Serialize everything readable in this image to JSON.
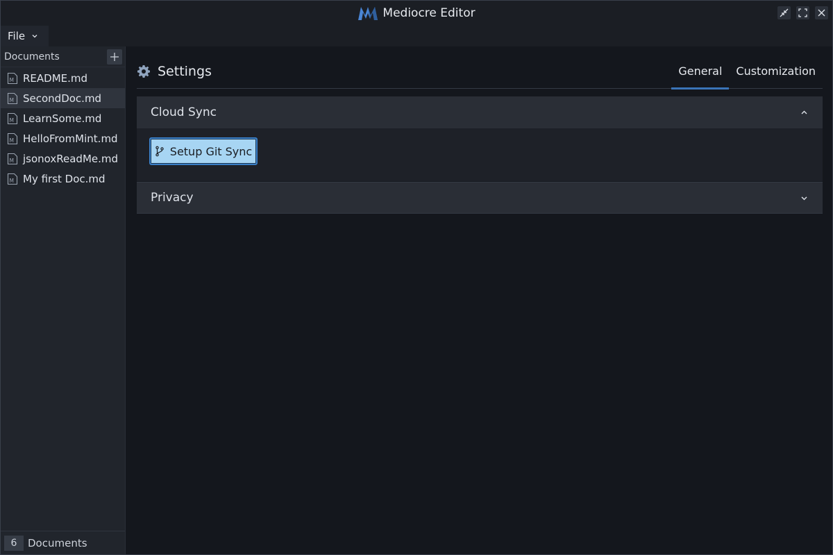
{
  "window": {
    "title": "Mediocre Editor",
    "controls": [
      "minimize-icon",
      "maximize-icon",
      "close-icon"
    ]
  },
  "menubar": {
    "file_label": "File"
  },
  "sidebar": {
    "header": "Documents",
    "documents": [
      {
        "name": "README.md",
        "active": false
      },
      {
        "name": "SecondDoc.md",
        "active": true
      },
      {
        "name": "LearnSome.md",
        "active": false
      },
      {
        "name": "HelloFromMint.md",
        "active": false
      },
      {
        "name": "jsonoxReadMe.md",
        "active": false
      },
      {
        "name": "My first Doc.md",
        "active": false
      }
    ],
    "footer": {
      "count": "6",
      "label": "Documents"
    }
  },
  "settings": {
    "title": "Settings",
    "tabs": [
      {
        "label": "General",
        "active": true
      },
      {
        "label": "Customization",
        "active": false
      }
    ],
    "sections": [
      {
        "title": "Cloud Sync",
        "expanded": true,
        "button_label": "Setup Git Sync"
      },
      {
        "title": "Privacy",
        "expanded": false
      }
    ]
  },
  "colors": {
    "accent": "#3a74b8",
    "button_bg": "#a7d5f3",
    "logo": "#4a86d6"
  }
}
